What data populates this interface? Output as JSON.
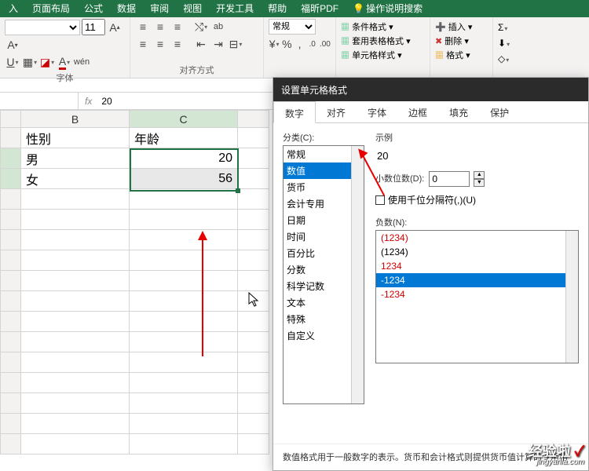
{
  "ribbon": {
    "tabs": [
      "入",
      "页面布局",
      "公式",
      "数据",
      "审阅",
      "视图",
      "开发工具",
      "帮助",
      "福昕PDF"
    ],
    "tell_me_icon": "💡",
    "tell_me": "操作说明搜索",
    "font_size": "11",
    "number_format": "常规",
    "group_font": "字体",
    "group_align": "对齐方式",
    "cond_fmt": "条件格式 ▾",
    "table_fmt": "套用表格格式 ▾",
    "cell_styles": "单元格样式 ▾",
    "insert": "插入 ▾",
    "delete": "删除 ▾",
    "format": "格式 ▾"
  },
  "formula_bar": {
    "name": "",
    "value": "20"
  },
  "sheet": {
    "colB": "B",
    "colC": "C",
    "rows": [
      {
        "b": "性别",
        "c": "年龄"
      },
      {
        "b": "男",
        "c": "20"
      },
      {
        "b": "女",
        "c": "56"
      }
    ]
  },
  "dialog": {
    "title": "设置单元格格式",
    "tabs": [
      "数字",
      "对齐",
      "字体",
      "边框",
      "填充",
      "保护"
    ],
    "category_label": "分类(C):",
    "categories": [
      "常规",
      "数值",
      "货币",
      "会计专用",
      "日期",
      "时间",
      "百分比",
      "分数",
      "科学记数",
      "文本",
      "特殊",
      "自定义"
    ],
    "selected_category": "数值",
    "sample_label": "示例",
    "sample_value": "20",
    "decimal_label": "小数位数(D):",
    "decimal_value": "0",
    "thousand_label": "使用千位分隔符(,)(U)",
    "negative_label": "负数(N):",
    "negatives": [
      "(1234)",
      "(1234)",
      "1234",
      "-1234",
      "-1234"
    ],
    "footer": "数值格式用于一般数字的表示。货币和会计格式则提供货币值计算的专用格"
  },
  "watermark": {
    "line1": "经验啦",
    "check": "✓",
    "line2": "jingyanla.com"
  }
}
